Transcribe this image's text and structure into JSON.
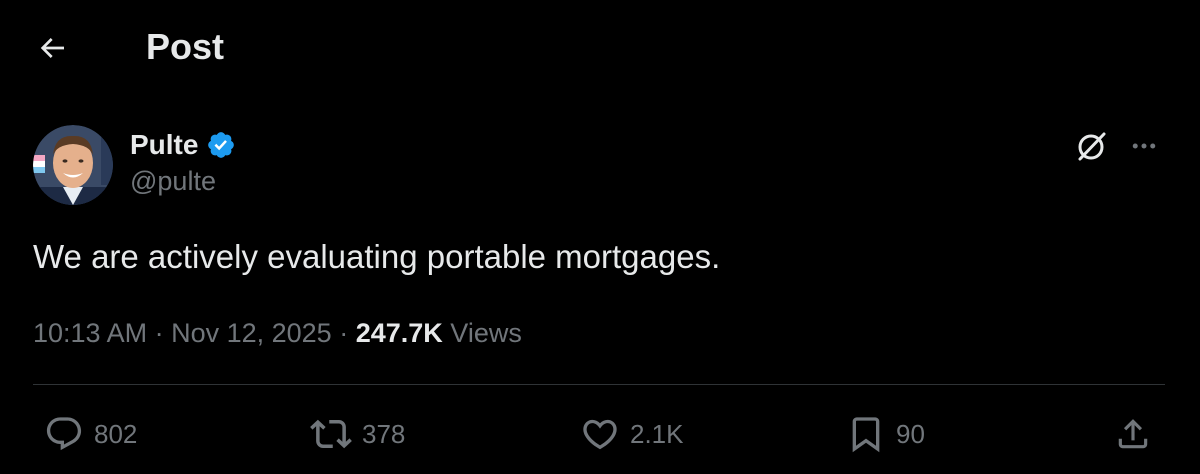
{
  "header": {
    "back_icon": "arrow-left-icon",
    "title": "Post"
  },
  "author": {
    "name": "Pulte",
    "handle": "@pulte",
    "verified": true,
    "verified_color": "#1d9bf0",
    "avatar_icon": "profile-photo"
  },
  "actions_top": {
    "grok_icon": "grok-icon",
    "more_icon": "more-horizontal-icon"
  },
  "post": {
    "text": "We are actively evaluating portable mortgages.",
    "time": "10:13 AM",
    "separator": " · ",
    "date": "Nov 12, 2025",
    "views_count": "247.7K",
    "views_label": "Views"
  },
  "engagement": {
    "replies": "802",
    "reposts": "378",
    "likes": "2.1K",
    "bookmarks": "90",
    "share_icon": "share-icon"
  },
  "colors": {
    "background": "#000000",
    "text_primary": "#e7e9ea",
    "text_secondary": "#71767b",
    "divider": "#2f3336"
  }
}
